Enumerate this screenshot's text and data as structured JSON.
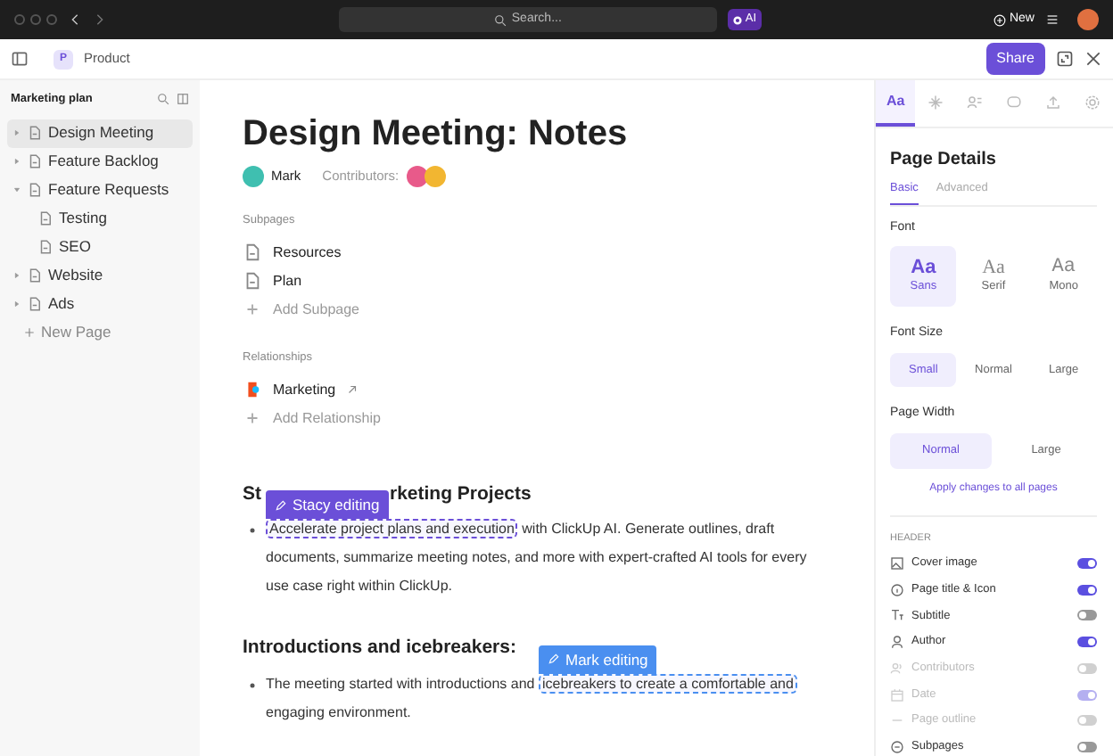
{
  "topbar": {
    "search_placeholder": "Search...",
    "ai_badge": "AI",
    "new_button": "New"
  },
  "toolbar": {
    "space_letter": "P",
    "breadcrumb": "Product",
    "share_button": "Share"
  },
  "sidebar": {
    "title": "Marketing plan",
    "new_page": "New Page",
    "items": [
      {
        "label": "Design Meeting",
        "selected": true,
        "expanded": false
      },
      {
        "label": "Feature Backlog",
        "selected": false,
        "expanded": false
      },
      {
        "label": "Feature Requests",
        "selected": false,
        "expanded": true,
        "children": [
          {
            "label": "Testing",
            "selected": false
          },
          {
            "label": "SEO",
            "selected": false
          }
        ]
      },
      {
        "label": "Website",
        "selected": false,
        "expanded": false
      },
      {
        "label": "Ads",
        "selected": false,
        "expanded": false
      }
    ]
  },
  "document": {
    "title": "Design Meeting: Notes",
    "author": {
      "name": "Mark",
      "color": "#3fbfb0"
    },
    "contributors_label": "Contributors:",
    "contributors": [
      {
        "color": "#e85a8a"
      },
      {
        "color": "#f2b631"
      }
    ],
    "subpages": {
      "label": "Subpages",
      "items": [
        {
          "label": "Resources",
          "kind": "page"
        },
        {
          "label": "Plan",
          "kind": "page"
        },
        {
          "label": "Add Subpage",
          "kind": "add"
        }
      ]
    },
    "relationships": {
      "label": "Relationships",
      "items": [
        {
          "label": "Marketing",
          "kind": "link"
        },
        {
          "label": "Add Relationship",
          "kind": "add"
        }
      ]
    },
    "sections": [
      {
        "heading_parts": [
          "St",
          "rketing Projects"
        ],
        "editor": {
          "label": "Stacy editing",
          "color": "#6b4fd8"
        },
        "bullet": {
          "highlight": "Accelerate project plans and execution",
          "after": " with ClickUp AI. Generate outlines, draft documents, summarize meeting notes, and more with expert-crafted AI tools for every use case right within ClickUp."
        }
      },
      {
        "heading_parts": [
          "Introductions and icebreakers:"
        ],
        "editor": {
          "label": "Mark editing",
          "color": "#4a8ff0"
        },
        "bullet": {
          "before": "The meeting started with introductions and ",
          "highlight": "icebreakers to create a comfortable and",
          "after": " engaging environment."
        }
      }
    ]
  },
  "panel": {
    "tabs": [
      {
        "kind": "text",
        "label": "Aa",
        "selected": true
      },
      {
        "kind": "sparkle",
        "selected": false
      },
      {
        "kind": "people",
        "selected": false
      },
      {
        "kind": "chat",
        "selected": false
      },
      {
        "kind": "upload",
        "selected": false
      },
      {
        "kind": "gear",
        "selected": false
      }
    ],
    "title": "Page Details",
    "subtabs": [
      {
        "label": "Basic",
        "selected": true
      },
      {
        "label": "Advanced",
        "selected": false
      }
    ],
    "font": {
      "label": "Font",
      "options": [
        {
          "kind": "sans",
          "sample": "Aa",
          "label": "Sans",
          "selected": true
        },
        {
          "kind": "serif",
          "sample": "Aa",
          "label": "Serif",
          "selected": false
        },
        {
          "kind": "mono",
          "sample": "Aa",
          "label": "Mono",
          "selected": false
        }
      ]
    },
    "font_size": {
      "label": "Font Size",
      "options": [
        {
          "label": "Small",
          "selected": true
        },
        {
          "label": "Normal",
          "selected": false
        },
        {
          "label": "Large",
          "selected": false
        }
      ]
    },
    "page_width": {
      "label": "Page Width",
      "options": [
        {
          "label": "Normal",
          "selected": true
        },
        {
          "label": "Large",
          "selected": false
        }
      ]
    },
    "apply_link": "Apply changes to all pages",
    "header_label": "HEADER",
    "toggles": [
      {
        "kind": "image",
        "label": "Cover image",
        "on": true,
        "disabled": false
      },
      {
        "kind": "info",
        "label": "Page title & Icon",
        "on": true,
        "disabled": false
      },
      {
        "kind": "text",
        "label": "Subtitle",
        "on": false,
        "disabled": false
      },
      {
        "kind": "person",
        "label": "Author",
        "on": true,
        "disabled": false
      },
      {
        "kind": "people",
        "label": "Contributors",
        "on": false,
        "disabled": true
      },
      {
        "kind": "calendar",
        "label": "Date",
        "on": true,
        "disabled": true
      },
      {
        "kind": "list",
        "label": "Page outline",
        "on": false,
        "disabled": true
      },
      {
        "kind": "pages",
        "label": "Subpages",
        "on": false,
        "disabled": false
      }
    ]
  }
}
